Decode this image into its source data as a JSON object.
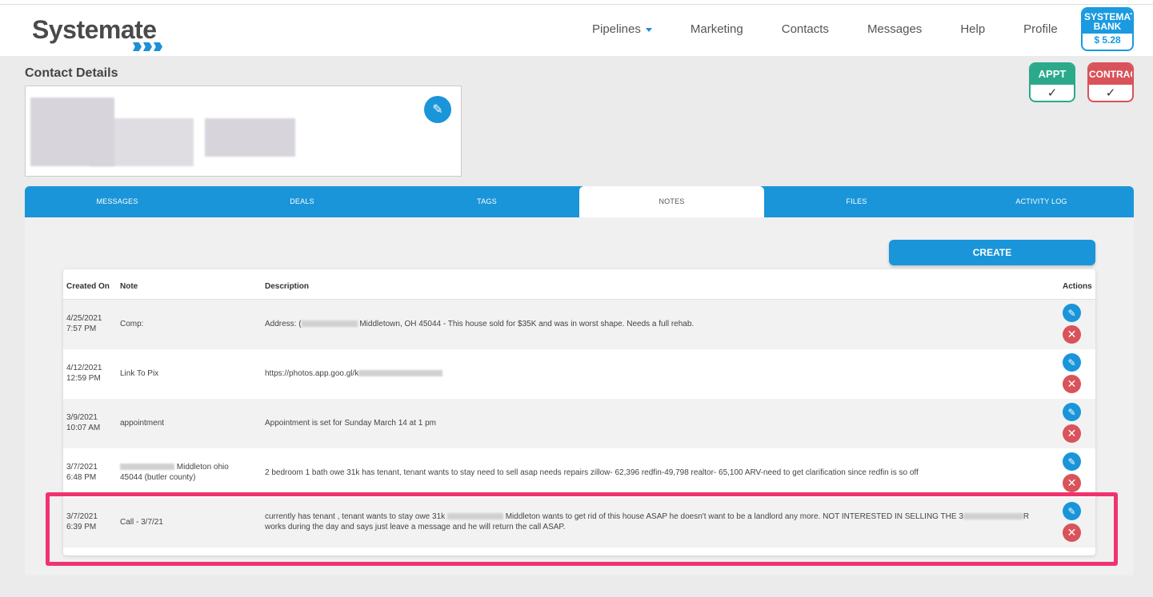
{
  "header": {
    "logo_text": "Systemate",
    "nav": [
      "Pipelines",
      "Marketing",
      "Contacts",
      "Messages",
      "Help",
      "Profile"
    ],
    "bank_label": "SYSTEMATE BANK",
    "bank_amount": "$ 5.28"
  },
  "contact": {
    "title": "Contact Details",
    "badges": [
      {
        "label": "APPT",
        "check": "✓"
      },
      {
        "label": "CONTRACT",
        "check": "✓"
      }
    ]
  },
  "tabs": [
    "MESSAGES",
    "DEALS",
    "TAGS",
    "NOTES",
    "FILES",
    "ACTIVITY LOG"
  ],
  "active_tab": "NOTES",
  "notes": {
    "create_label": "CREATE",
    "columns": [
      "Created On",
      "Note",
      "Description",
      "Actions"
    ],
    "rows": [
      {
        "date": "4/25/2021",
        "time": "7:57 PM",
        "note": "Comp:",
        "desc_pre": "Address: (",
        "desc_post": " Middletown, OH 45044 - This house sold for $35K and was in worst shape. Needs a full rehab."
      },
      {
        "date": "4/12/2021",
        "time": "12:59 PM",
        "note": "Link To Pix",
        "desc_pre": "https://photos.app.goo.gl/k",
        "desc_post": ""
      },
      {
        "date": "3/9/2021",
        "time": "10:07 AM",
        "note": "appointment",
        "desc_pre": "Appointment is set for Sunday March 14 at 1 pm",
        "desc_post": ""
      },
      {
        "date": "3/7/2021",
        "time": "6:48 PM",
        "note": "Middleton ohio 45044 (butler county)",
        "desc_pre": "2 bedroom 1 bath owe 31k has tenant, tenant wants to stay need to sell asap needs repairs zillow- 62,396 redfin-49,798 realtor- 65,100 ARV-need to get clarification since redfin is so off",
        "desc_post": ""
      },
      {
        "date": "3/7/2021",
        "time": "6:39 PM",
        "note": "Call - 3/7/21",
        "desc_pre": "currently has tenant , tenant wants to stay owe 31k",
        "desc_post": "Middleton wants to get rid of this house ASAP he doesn't want to be a landlord any more. NOT INTERESTED IN SELLING THE 3",
        "desc_line2": "works during the day and says just leave a message and he will return the call ASAP."
      }
    ]
  },
  "colors": {
    "accent": "#1a95d9",
    "appt": "#2aa98b",
    "contract": "#d9535a",
    "highlight": "#f0336f"
  }
}
